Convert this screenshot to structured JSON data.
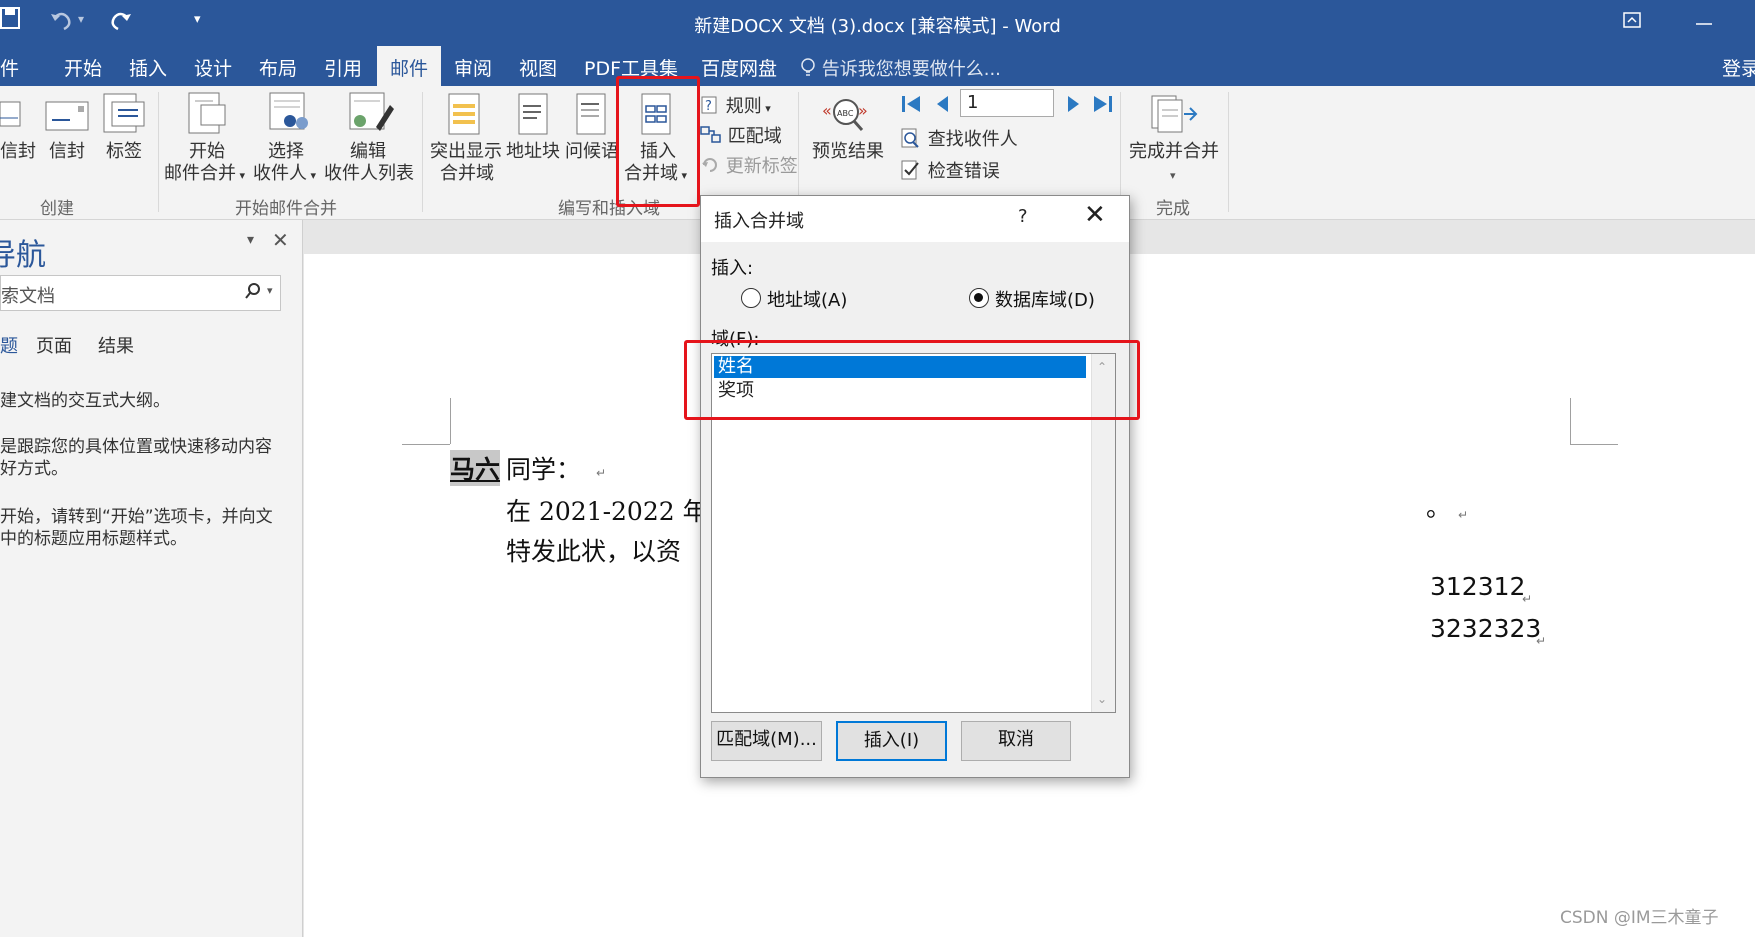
{
  "window": {
    "title": "新建DOCX 文档 (3).docx [兼容模式] - Word"
  },
  "menu": {
    "tabs": [
      "件",
      "开始",
      "插入",
      "设计",
      "布局",
      "引用",
      "邮件",
      "审阅",
      "视图",
      "PDF工具集",
      "百度网盘"
    ],
    "active": "邮件",
    "tell_me": "告诉我您想要做什么...",
    "login": "登录"
  },
  "ribbon": {
    "create": {
      "items": [
        "信封",
        "信封",
        "标签"
      ],
      "group_label": "创建"
    },
    "start_merge": {
      "start_l1": "开始",
      "start_l2": "邮件合并",
      "select_l1": "选择",
      "select_l2": "收件人",
      "edit_l1": "编辑",
      "edit_l2": "收件人列表",
      "group_label": "开始邮件合并"
    },
    "write_insert": {
      "highlight_l1": "突出显示",
      "highlight_l2": "合并域",
      "address_block": "地址块",
      "greeting": "问候语",
      "insert_l1": "插入",
      "insert_l2": "合并域",
      "rules": "规则",
      "match_fields": "匹配域",
      "update_labels": "更新标签",
      "group_label": "编写和插入域"
    },
    "preview": {
      "preview_results": "预览结果",
      "record_number": "1",
      "find_recipient": "查找收件人",
      "check_errors": "检查错误"
    },
    "finish": {
      "finish_merge": "完成并合并",
      "group_label": "完成"
    }
  },
  "nav_pane": {
    "title": "导航",
    "search_placeholder": "索文档",
    "tabs": [
      "题",
      "页面",
      "结果"
    ],
    "lines": [
      "建文档的交互式大纲。",
      "是跟踪您的具体位置或快速移动内容",
      "好方式。",
      "开始，请转到“开始”选项卡，并向文",
      "中的标题应用标题样式。"
    ]
  },
  "document": {
    "field_value": "马六",
    "line1_rest": "同学：",
    "line2": "在 2021-2022 年",
    "line3": "特发此状，以资",
    "right1": "312312",
    "right2": "3232323",
    "para_mark": "↵"
  },
  "dialog": {
    "title": "插入合并域",
    "help": "?",
    "close": "✕",
    "insert_label": "插入:",
    "radio_address": "地址域(A)",
    "radio_database": "数据库域(D)",
    "selected_radio": "database",
    "fields_label": "域(F):",
    "fields": [
      "姓名",
      "奖项"
    ],
    "selected_field": "姓名",
    "btn_match": "匹配域(M)...",
    "btn_insert": "插入(I)",
    "btn_cancel": "取消"
  },
  "watermark": "CSDN @IM三木童子",
  "colors": {
    "title_bar": "#2b579a",
    "ribbon_bg": "#f3f3f3",
    "highlight_red": "#e5141b",
    "selection_blue": "#0078d7"
  }
}
